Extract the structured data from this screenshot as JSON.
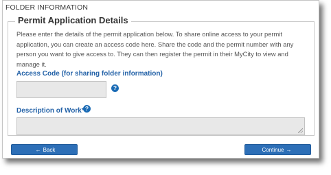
{
  "section": {
    "title": "FOLDER INFORMATION"
  },
  "permit": {
    "legend": "Permit Application Details",
    "description": "Please enter the details of the permit application below. To share online access to your permit application, you can create an access code here. Share the code and the permit number with any person you want to give access to. They can then register the permit in their MyCity to view and manage it."
  },
  "access_code": {
    "label": "Access Code (for sharing folder information)",
    "value": "",
    "help_icon": "question-circle-icon",
    "help_glyph": "?"
  },
  "work_description": {
    "label": "Description of Work*",
    "value": "",
    "help_icon": "question-circle-icon",
    "help_glyph": "?"
  },
  "buttons": {
    "back_label": "Back",
    "back_icon": "arrow-left-icon",
    "back_glyph": "←",
    "continue_label": "Continue",
    "continue_icon": "arrow-right-icon",
    "continue_glyph": "→"
  },
  "colors": {
    "accent": "#2d6fb7",
    "label": "#2563a8",
    "input_bg": "#e8e8e8"
  }
}
